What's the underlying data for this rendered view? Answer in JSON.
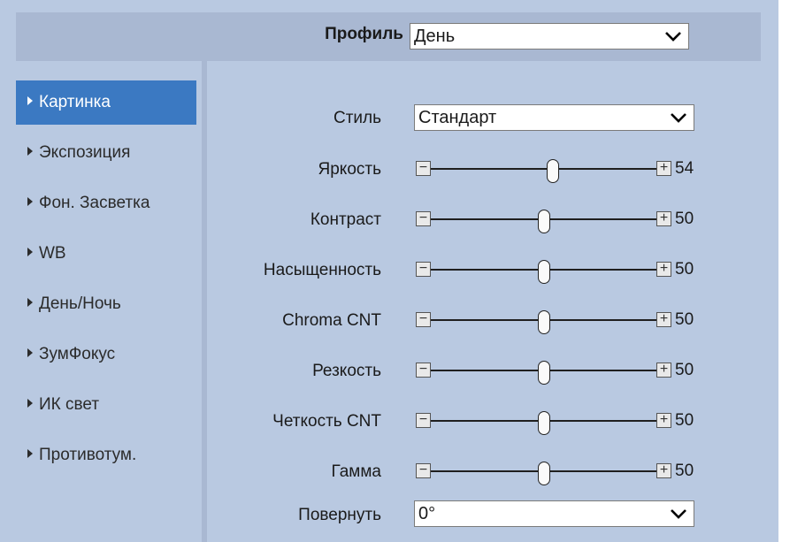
{
  "header": {
    "profile_label": "Профиль",
    "profile_value": "День"
  },
  "sidebar": {
    "items": [
      {
        "label": "Картинка",
        "active": true
      },
      {
        "label": "Экспозиция",
        "active": false
      },
      {
        "label": "Фон. Засветка",
        "active": false
      },
      {
        "label": "WB",
        "active": false
      },
      {
        "label": "День/Ночь",
        "active": false
      },
      {
        "label": "ЗумФокус",
        "active": false
      },
      {
        "label": "ИК свет",
        "active": false
      },
      {
        "label": "Противотум.",
        "active": false
      }
    ]
  },
  "form": {
    "style_label": "Стиль",
    "style_value": "Стандарт",
    "sliders": [
      {
        "label": "Яркость",
        "value": "54",
        "level": 54
      },
      {
        "label": "Контраст",
        "value": "50",
        "level": 50
      },
      {
        "label": "Насыщенность",
        "value": "50",
        "level": 50
      },
      {
        "label": "Chroma CNT",
        "value": "50",
        "level": 50
      },
      {
        "label": "Резкость",
        "value": "50",
        "level": 50
      },
      {
        "label": "Четкость CNT",
        "value": "50",
        "level": 50
      },
      {
        "label": "Гамма",
        "value": "50",
        "level": 50
      }
    ],
    "rotate_label": "Повернуть",
    "rotate_value": "0°"
  },
  "icons": {
    "minus": "−",
    "plus": "+",
    "dropdown": "chevron-down-icon"
  },
  "colors": {
    "panel_bg": "#b9c9e1",
    "header_bg": "#a9b8d2",
    "active_item": "#3b79c2"
  }
}
